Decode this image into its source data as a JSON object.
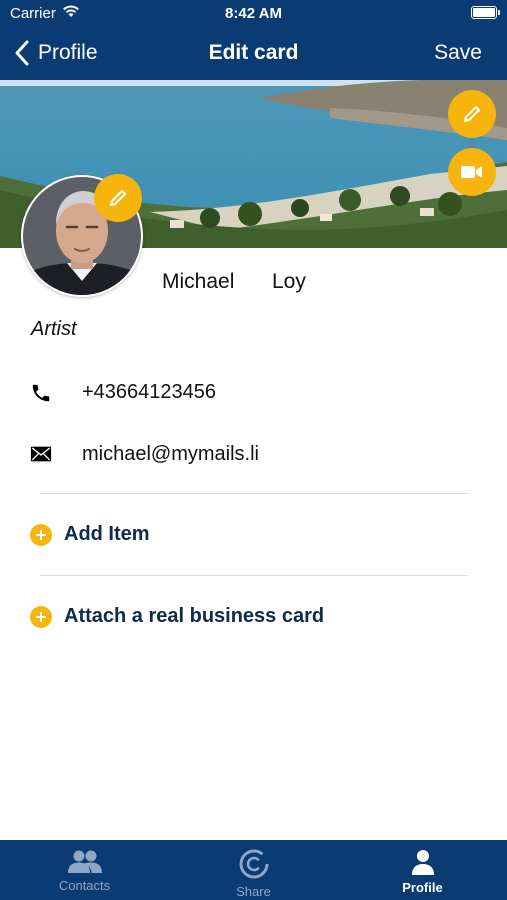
{
  "status_bar": {
    "carrier": "Carrier",
    "time": "8:42 AM"
  },
  "nav": {
    "back_label": "Profile",
    "title": "Edit card",
    "save_label": "Save"
  },
  "profile": {
    "first_name": "Michael",
    "last_name": "Loy",
    "role": "Artist",
    "phone": "+43664123456",
    "email": "michael@mymails.li"
  },
  "actions": [
    {
      "label": "Add Item"
    },
    {
      "label": "Attach a real business card"
    }
  ],
  "tabs": [
    {
      "label": "Contacts",
      "icon": "contacts-icon",
      "active": false
    },
    {
      "label": "Share",
      "icon": "share-icon",
      "active": false
    },
    {
      "label": "Profile",
      "icon": "profile-icon",
      "active": true
    }
  ],
  "colors": {
    "nav_bg": "#0b3b73",
    "accent": "#f7b40c",
    "action_text": "#0e2a4d"
  }
}
